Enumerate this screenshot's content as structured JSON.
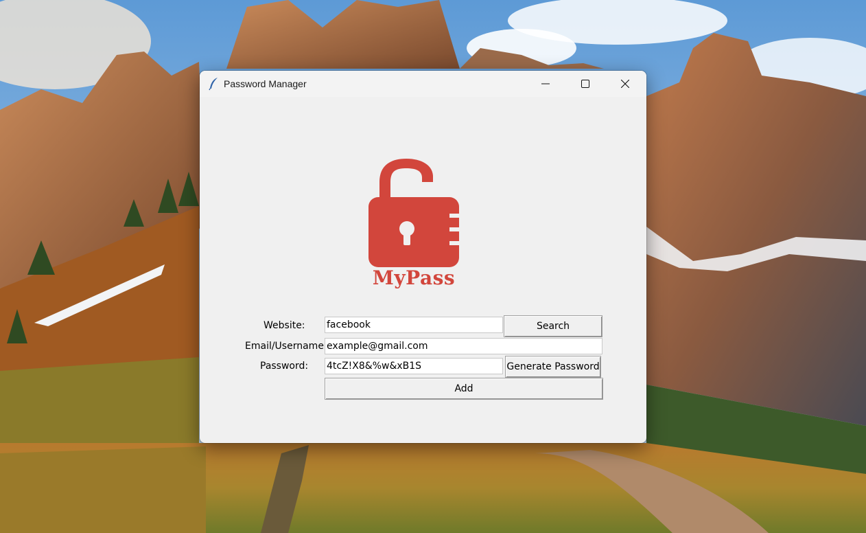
{
  "window": {
    "title": "Password Manager",
    "controls": {
      "minimize_icon": "minimize-icon",
      "maximize_icon": "maximize-icon",
      "close_icon": "close-icon"
    }
  },
  "logo": {
    "icon": "open-padlock-icon",
    "brand": "MyPass",
    "color": "#d2463c"
  },
  "form": {
    "website": {
      "label": "Website:",
      "value": "facebook"
    },
    "email": {
      "label": "Email/Username:",
      "value": "example@gmail.com"
    },
    "password": {
      "label": "Password:",
      "value": "4tcZ!X8&%w&xB1S"
    },
    "search_label": "Search",
    "generate_label": "Generate Password",
    "add_label": "Add"
  }
}
